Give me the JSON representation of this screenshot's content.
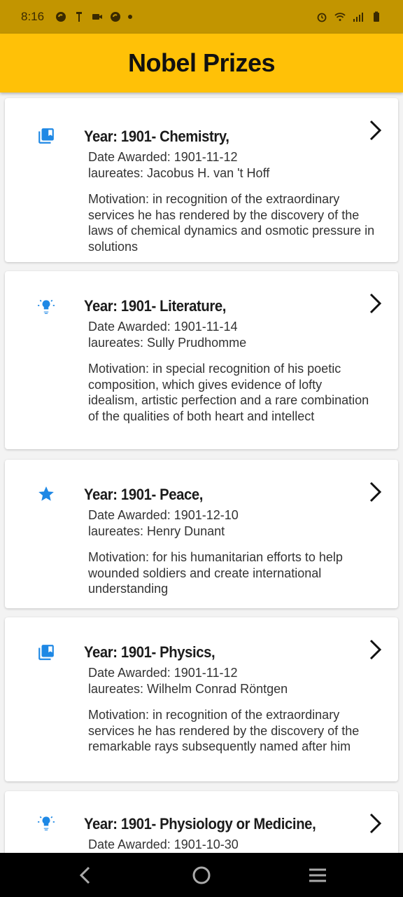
{
  "status_bar": {
    "time": "8:16",
    "left_icons": [
      "sync-icon",
      "antenna-icon",
      "video-icon",
      "sync-icon",
      "notification-dot"
    ],
    "right_icons": [
      "alarm-icon",
      "wifi-icon",
      "signal-icon",
      "battery-icon"
    ]
  },
  "app_bar": {
    "title": "Nobel Prizes",
    "color": "#ffc107"
  },
  "accent_color": "#1e88e5",
  "prizes": [
    {
      "icon": "book-icon",
      "title": "Year: 1901- Chemistry,",
      "date_awarded": "Date Awarded: 1901-11-12",
      "laureates": "laureates: Jacobus H. van 't Hoff",
      "motivation": "Motivation: in recognition of the extraordinary services he has rendered by the discovery of the laws of chemical dynamics and osmotic pressure in solutions"
    },
    {
      "icon": "lightbulb-icon",
      "title": "Year: 1901- Literature,",
      "date_awarded": "Date Awarded: 1901-11-14",
      "laureates": "laureates: Sully Prudhomme",
      "motivation": "Motivation: in special recognition of his poetic composition, which gives evidence of lofty idealism, artistic perfection and a rare combination of the qualities of both heart and intellect"
    },
    {
      "icon": "star-icon",
      "title": "Year: 1901- Peace,",
      "date_awarded": "Date Awarded: 1901-12-10",
      "laureates": "laureates: Henry Dunant",
      "motivation": "Motivation: for his humanitarian efforts to help wounded soldiers and create international understanding"
    },
    {
      "icon": "book-icon",
      "title": "Year: 1901- Physics,",
      "date_awarded": "Date Awarded: 1901-11-12",
      "laureates": "laureates: Wilhelm Conrad Röntgen",
      "motivation": "Motivation: in recognition of the extraordinary services he has rendered by the discovery of the remarkable rays subsequently named after him"
    },
    {
      "icon": "lightbulb-icon",
      "title": "Year: 1901- Physiology or Medicine,",
      "date_awarded": "Date Awarded: 1901-10-30",
      "laureates": "",
      "motivation": ""
    }
  ],
  "nav_bar": {
    "buttons": [
      "back-icon",
      "home-icon",
      "recents-icon"
    ]
  }
}
